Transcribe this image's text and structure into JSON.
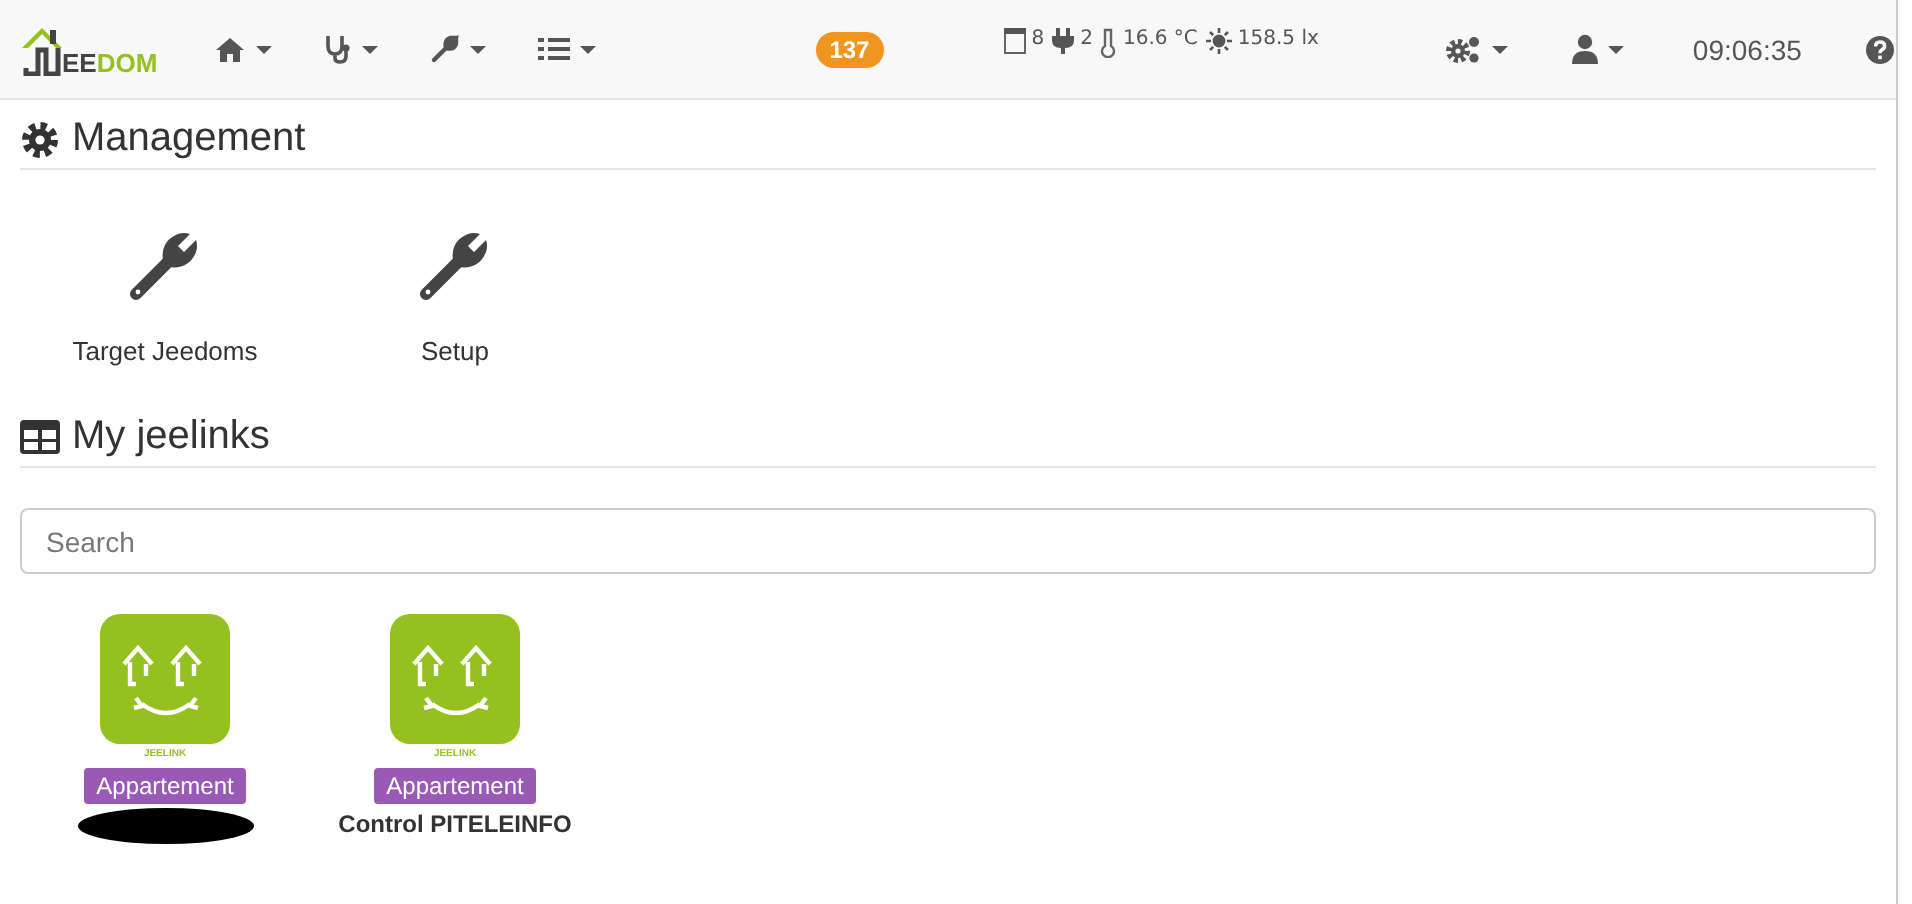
{
  "navbar": {
    "logo": {
      "part_dark": "EE",
      "part_green": "DOM"
    },
    "menus": [
      {
        "kind": "home"
      },
      {
        "kind": "health"
      },
      {
        "kind": "tools"
      },
      {
        "kind": "tasks"
      }
    ],
    "message_count": "137",
    "summary": [
      {
        "kind": "shutter",
        "value": "8"
      },
      {
        "kind": "plug",
        "value": "2"
      },
      {
        "kind": "temperature",
        "value": "16.6 °C"
      },
      {
        "kind": "light",
        "value": "158.5 lx"
      }
    ],
    "right_menus": [
      {
        "kind": "settings"
      },
      {
        "kind": "user"
      }
    ],
    "clock": "09:06:35"
  },
  "management": {
    "title": "Management",
    "items": [
      {
        "label": "Target Jeedoms"
      },
      {
        "label": "Setup"
      }
    ]
  },
  "jeelinks": {
    "title": "My jeelinks",
    "search": {
      "placeholder": "Search"
    },
    "items": [
      {
        "caption": "JEELINK",
        "tag": "Appartement",
        "redacted": true
      },
      {
        "caption": "JEELINK",
        "tag": "Appartement",
        "name": "Control PITELEINFO",
        "redacted": false
      }
    ]
  }
}
